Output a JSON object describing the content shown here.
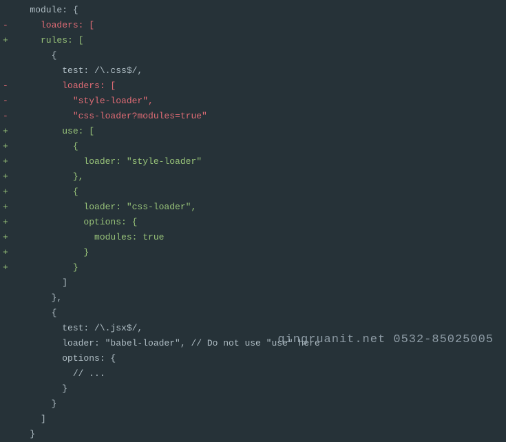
{
  "watermark": "qingruanit.net 0532-85025005",
  "lines": [
    {
      "type": "ctx",
      "marker": " ",
      "text": "   module: {"
    },
    {
      "type": "del",
      "marker": "-",
      "text": "     loaders: ["
    },
    {
      "type": "add",
      "marker": "+",
      "text": "     rules: ["
    },
    {
      "type": "ctx",
      "marker": " ",
      "text": "       {"
    },
    {
      "type": "ctx",
      "marker": " ",
      "text": "         test: /\\.css$/,"
    },
    {
      "type": "del",
      "marker": "-",
      "text": "         loaders: ["
    },
    {
      "type": "del",
      "marker": "-",
      "text": "           \"style-loader\","
    },
    {
      "type": "del",
      "marker": "-",
      "text": "           \"css-loader?modules=true\""
    },
    {
      "type": "add",
      "marker": "+",
      "text": "         use: ["
    },
    {
      "type": "add",
      "marker": "+",
      "text": "           {"
    },
    {
      "type": "add",
      "marker": "+",
      "text": "             loader: \"style-loader\""
    },
    {
      "type": "add",
      "marker": "+",
      "text": "           },"
    },
    {
      "type": "add",
      "marker": "+",
      "text": "           {"
    },
    {
      "type": "add",
      "marker": "+",
      "text": "             loader: \"css-loader\","
    },
    {
      "type": "add",
      "marker": "+",
      "text": "             options: {"
    },
    {
      "type": "add",
      "marker": "+",
      "text": "               modules: true"
    },
    {
      "type": "add",
      "marker": "+",
      "text": "             }"
    },
    {
      "type": "add",
      "marker": "+",
      "text": "           }"
    },
    {
      "type": "ctx",
      "marker": " ",
      "text": "         ]"
    },
    {
      "type": "ctx",
      "marker": " ",
      "text": "       },"
    },
    {
      "type": "ctx",
      "marker": " ",
      "text": "       {"
    },
    {
      "type": "ctx",
      "marker": " ",
      "text": "         test: /\\.jsx$/,"
    },
    {
      "type": "ctx",
      "marker": " ",
      "text": "         loader: \"babel-loader\", // Do not use \"use\" here"
    },
    {
      "type": "ctx",
      "marker": " ",
      "text": "         options: {"
    },
    {
      "type": "ctx",
      "marker": " ",
      "text": "           // ..."
    },
    {
      "type": "ctx",
      "marker": " ",
      "text": "         }"
    },
    {
      "type": "ctx",
      "marker": " ",
      "text": "       }"
    },
    {
      "type": "ctx",
      "marker": " ",
      "text": "     ]"
    },
    {
      "type": "ctx",
      "marker": " ",
      "text": "   }"
    }
  ]
}
